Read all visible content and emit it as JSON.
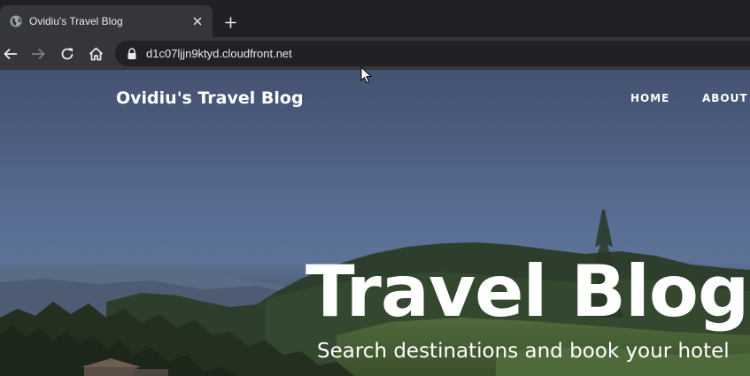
{
  "browser": {
    "tab_title": "Ovidiu's Travel Blog",
    "url": "d1c07ljjn9ktyd.cloudfront.net",
    "icons": {
      "favicon": "globe-icon",
      "tab_close": "close-icon",
      "new_tab": "plus-icon",
      "back": "arrow-left-icon",
      "forward": "arrow-right-icon",
      "reload": "reload-icon",
      "home": "home-icon",
      "security": "lock-icon"
    }
  },
  "site": {
    "brand": "Ovidiu's Travel Blog",
    "nav": [
      {
        "label": "HOME"
      },
      {
        "label": "ABOUT"
      }
    ],
    "hero": {
      "title": "Travel Blog",
      "subtitle": "Search destinations and book your hotel"
    }
  },
  "colors": {
    "chrome_dark": "#202124",
    "chrome_tab": "#35363a",
    "chrome_text": "#e8eaed",
    "hero_text": "#ffffff"
  }
}
